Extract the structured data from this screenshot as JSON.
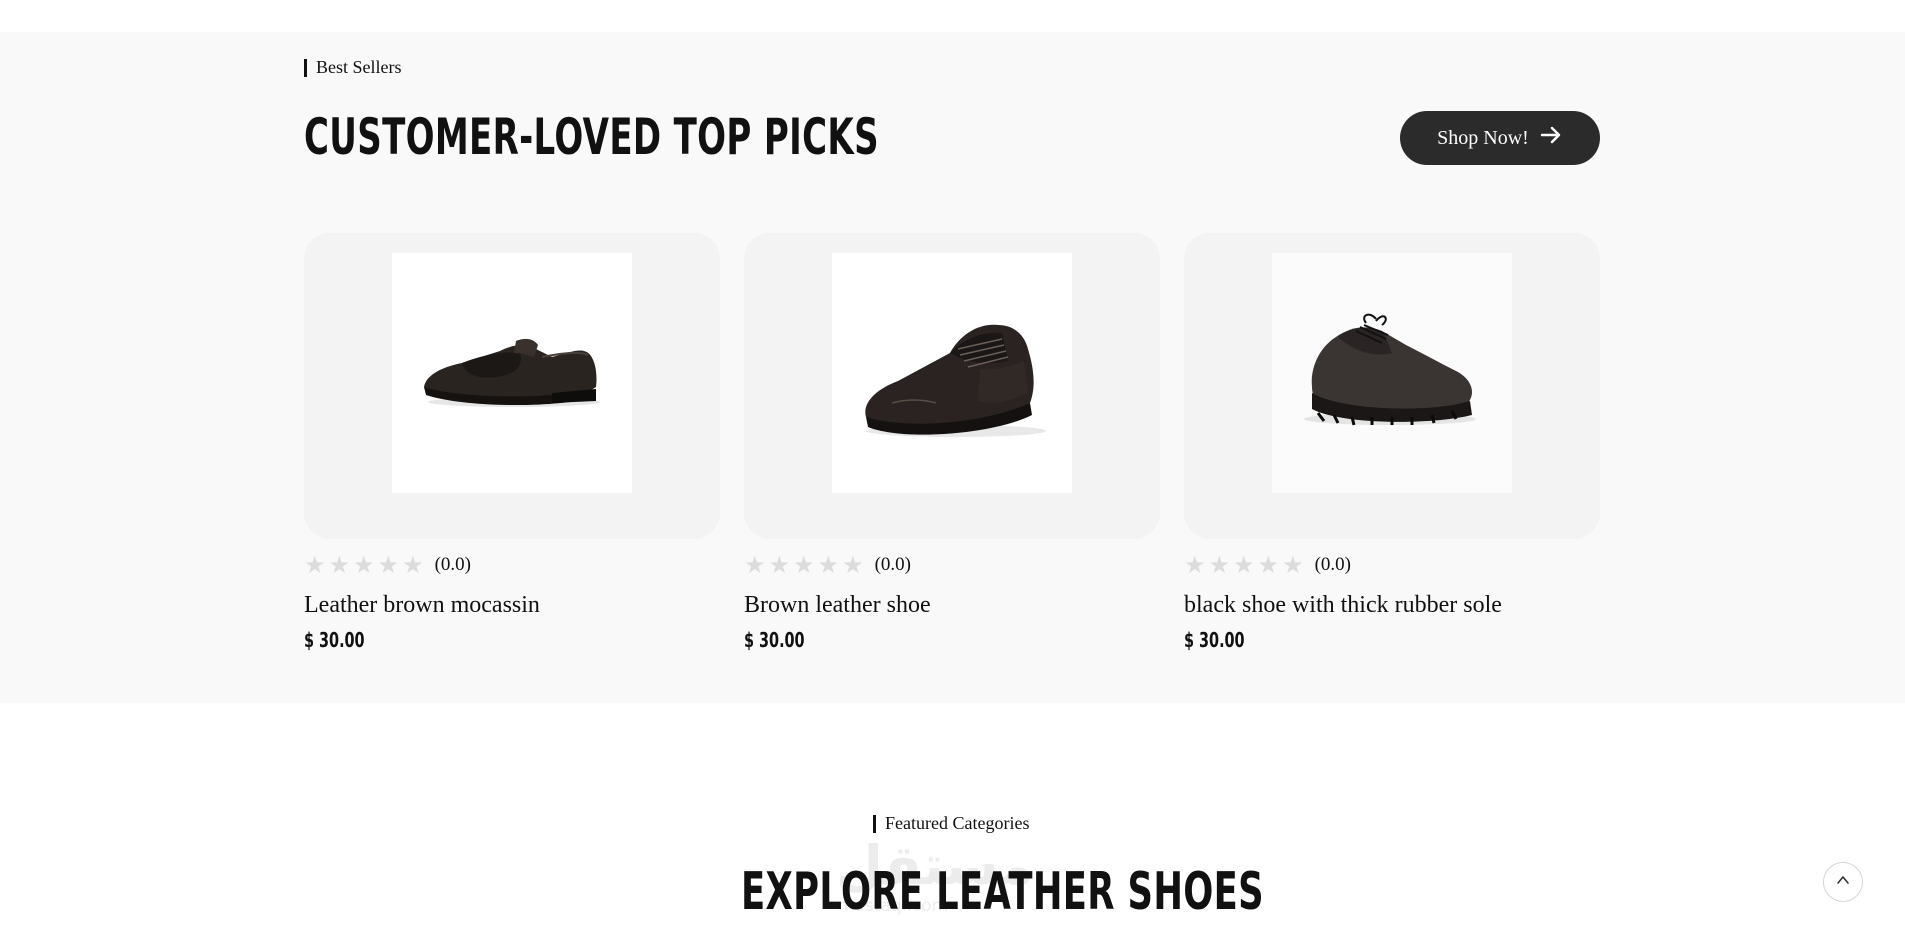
{
  "best_sellers": {
    "eyebrow": "Best Sellers",
    "title": "CUSTOMER-LOVED TOP PICKS",
    "shop_button": "Shop Now!",
    "products": [
      {
        "name": "Leather brown mocassin",
        "rating_text": "(0.0)",
        "rating": 0,
        "price": "$ 30.00",
        "image": "loafer-shoe"
      },
      {
        "name": "Brown leather shoe",
        "rating_text": "(0.0)",
        "rating": 0,
        "price": "$ 30.00",
        "image": "oxford-shoe"
      },
      {
        "name": "black shoe with thick rubber sole",
        "rating_text": "(0.0)",
        "rating": 0,
        "price": "$ 30.00",
        "image": "derby-shoe"
      }
    ]
  },
  "featured": {
    "eyebrow": "Featured Categories",
    "title": "EXPLORE LEATHER SHOES"
  },
  "watermark": {
    "main": "مستقل",
    "sub": "mostaql.com"
  },
  "icons": {
    "shop_arrow": "arrow-right-icon",
    "scroll_top": "chevron-up-icon",
    "star": "star-icon"
  },
  "colors": {
    "section_bg": "#f9f9f9",
    "card_bg": "#f3f3f3",
    "button_bg": "#2b2b2b",
    "star_empty": "#dcdcdc"
  }
}
